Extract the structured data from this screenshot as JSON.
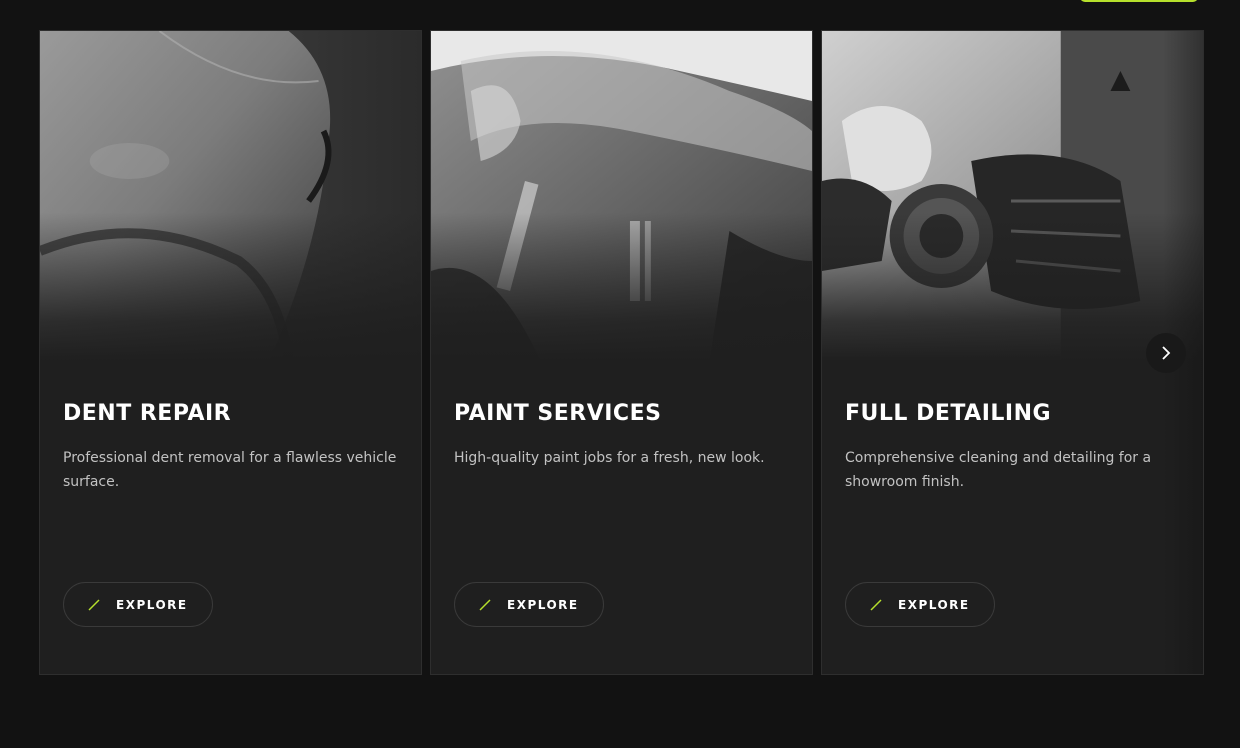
{
  "cards": [
    {
      "title": "DENT REPAIR",
      "description": "Professional dent removal for a flawless vehicle surface.",
      "button_label": "EXPLORE",
      "image": "car-body-closeup-image"
    },
    {
      "title": "PAINT SERVICES",
      "description": "High-quality paint jobs for a fresh, new look.",
      "button_label": "EXPLORE",
      "image": "car-masked-for-painting-image"
    },
    {
      "title": "FULL DETAILING",
      "description": "Comprehensive cleaning and detailing for a showroom finish.",
      "button_label": "EXPLORE",
      "image": "polishing-headlight-image"
    }
  ],
  "carousel": {
    "next_icon": "chevron-right-icon"
  },
  "colors": {
    "background": "#121212",
    "card_background": "#1f1f1f",
    "accent": "#b6e02c",
    "text_primary": "#ffffff",
    "text_secondary": "#c2c2c2"
  }
}
